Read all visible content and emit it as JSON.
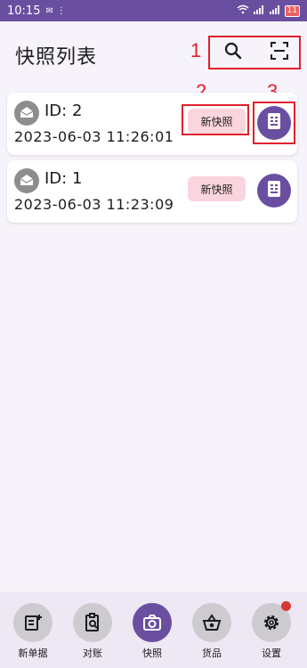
{
  "status_bar": {
    "time": "10:15",
    "left_icons": [
      "notification-icon",
      "signal-small-icon"
    ],
    "right_icons": [
      "wifi-icon",
      "cell-signal-icon",
      "cell-signal-icon"
    ],
    "battery": "11"
  },
  "app_bar": {
    "title": "快照列表",
    "actions": [
      "search-icon",
      "scan-icon"
    ]
  },
  "annotations": [
    "1",
    "2",
    "3"
  ],
  "snapshots": [
    {
      "id_label": "ID: 2",
      "timestamp": "2023-06-03 11:26:01",
      "button_label": "新快照"
    },
    {
      "id_label": "ID: 1",
      "timestamp": "2023-06-03 11:23:09",
      "button_label": "新快照"
    }
  ],
  "bottom_nav": {
    "items": [
      {
        "label": "新单据",
        "icon": "new-document-icon"
      },
      {
        "label": "对账",
        "icon": "clipboard-search-icon"
      },
      {
        "label": "快照",
        "icon": "camera-icon",
        "active": true
      },
      {
        "label": "货品",
        "icon": "basket-icon"
      },
      {
        "label": "设置",
        "icon": "gear-icon",
        "badge": true
      }
    ]
  },
  "colors": {
    "primary": "#6a4fa0",
    "chip_bg": "#fbd5dd",
    "annotation": "#e0202c",
    "background": "#f7f3fa"
  }
}
